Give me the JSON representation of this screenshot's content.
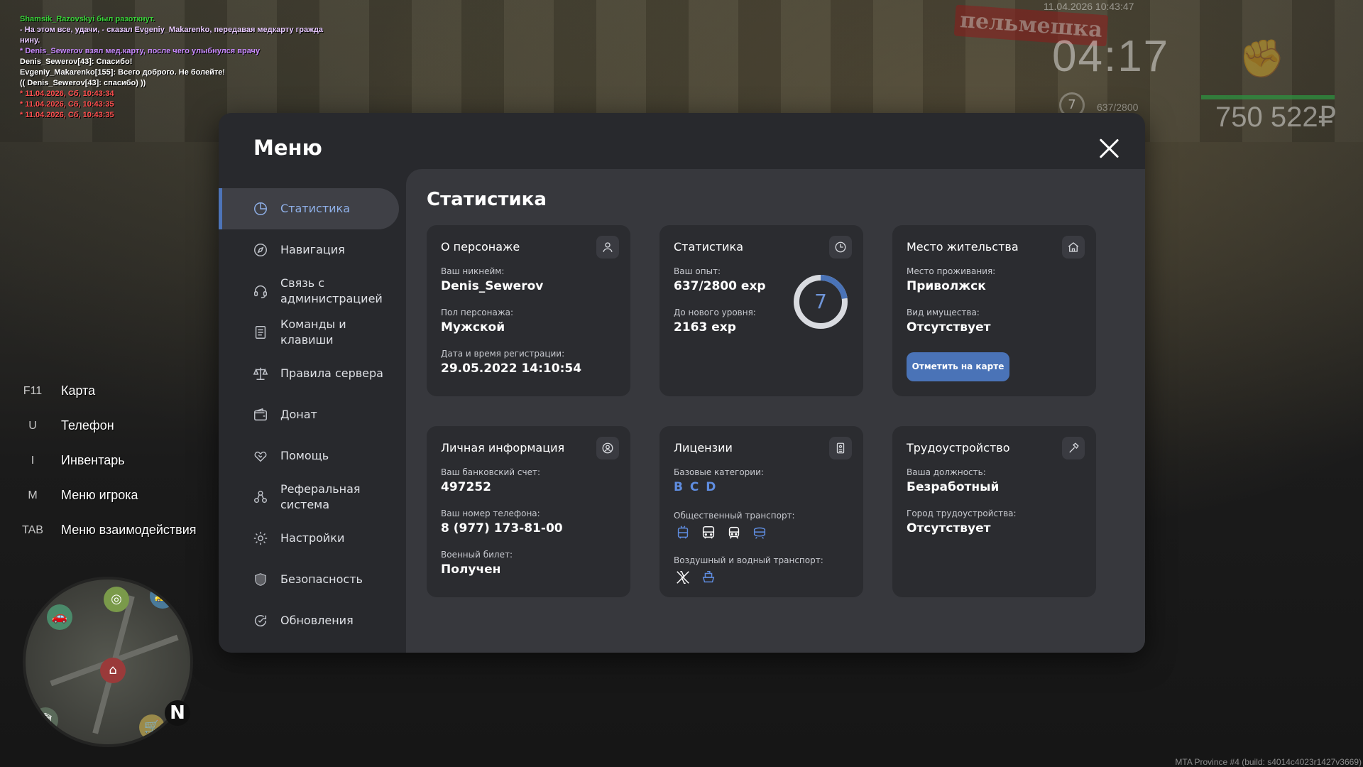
{
  "chat": [
    {
      "text": "Shamsik_Razovskyi был разоткнут.",
      "color": "#39d439"
    },
    {
      "text": "- На этом все, удачи, - сказал Evgeniy_Makarenko, передавая медкарту гражда",
      "color": "#e8c9ff"
    },
    {
      "text": "нину.",
      "color": "#e8c9ff"
    },
    {
      "text": "* Denis_Sewerov взял мед.карту, после чего улыбнулся врачу",
      "color": "#c98aff"
    },
    {
      "text": "Denis_Sewerov[43]: Спасибо!",
      "color": "#ffffff"
    },
    {
      "text": "Evgeniy_Makarenko[155]: Всего доброго. Не болейте!",
      "color": "#ffffff"
    },
    {
      "text": "(( Denis_Sewerov[43]: спасибо) ))",
      "color": "#ffffff"
    },
    {
      "text": "* 11.04.2026, Сб, 10:43:34",
      "color": "#ff4f4f"
    },
    {
      "text": "* 11.04.2026, Сб, 10:43:35",
      "color": "#ff4f4f"
    },
    {
      "text": "* 11.04.2026, Сб, 10:43:35",
      "color": "#ff4f4f"
    }
  ],
  "hud": {
    "datetime": "11.04.2026 10:43:47",
    "clock": "04:17",
    "level": "7",
    "exp": "637/2800",
    "money": "750 522₽"
  },
  "hotkeys": [
    {
      "key": "F11",
      "label": "Карта"
    },
    {
      "key": "U",
      "label": "Телефон"
    },
    {
      "key": "I",
      "label": "Инвентарь"
    },
    {
      "key": "M",
      "label": "Меню игрока"
    },
    {
      "key": "TAB",
      "label": "Меню взаимодействия"
    }
  ],
  "minimap": {
    "north": "N"
  },
  "build": "MTA Province #4 (build: s4014c4023r1427v3669)",
  "modal": {
    "title": "Меню",
    "content_title": "Статистика",
    "nav": [
      {
        "label": "Статистика",
        "icon": "chart-pie-icon"
      },
      {
        "label": "Навигация",
        "icon": "compass-icon"
      },
      {
        "label": "Связь с администрацией",
        "icon": "headset-icon"
      },
      {
        "label": "Команды и клавиши",
        "icon": "document-icon"
      },
      {
        "label": "Правила сервера",
        "icon": "scales-icon"
      },
      {
        "label": "Донат",
        "icon": "wallet-icon"
      },
      {
        "label": "Помощь",
        "icon": "handshake-icon"
      },
      {
        "label": "Реферальная система",
        "icon": "referral-icon"
      },
      {
        "label": "Настройки",
        "icon": "gear-icon"
      },
      {
        "label": "Безопасность",
        "icon": "shield-icon"
      },
      {
        "label": "Обновления",
        "icon": "refresh-icon"
      }
    ],
    "cards": {
      "character": {
        "title": "О персонаже",
        "nick_label": "Ваш никнейм:",
        "nick": "Denis_Sewerov",
        "gender_label": "Пол персонажа:",
        "gender": "Мужской",
        "reg_label": "Дата и время регистрации:",
        "reg": "29.05.2022 14:10:54"
      },
      "stats": {
        "title": "Статистика",
        "exp_label": "Ваш опыт:",
        "exp": "637/2800 exp",
        "next_label": "До нового уровня:",
        "next": "2163 exp",
        "level": "7",
        "progress": 0.2275
      },
      "residence": {
        "title": "Место жительства",
        "place_label": "Место проживания:",
        "place": "Приволжск",
        "property_label": "Вид имущества:",
        "property": "Отсутствует",
        "button": "Отметить на карте"
      },
      "personal": {
        "title": "Личная информация",
        "bank_label": "Ваш банковский счет:",
        "bank": "497252",
        "phone_label": "Ваш номер телефона:",
        "phone": "8 (977) 173-81-00",
        "military_label": "Военный билет:",
        "military": "Получен"
      },
      "licenses": {
        "title": "Лицензии",
        "base_label": "Базовые категории:",
        "base": "B C D",
        "public_label": "Общественный транспорт:",
        "public_icons": [
          "trolleybus-icon",
          "bus-icon",
          "tram-icon",
          "metro-icon"
        ],
        "air_label": "Воздушный и водный транспорт:",
        "air_icons": [
          "plane-icon",
          "boat-icon"
        ]
      },
      "job": {
        "title": "Трудоустройство",
        "position_label": "Ваша должность:",
        "position": "Безработный",
        "city_label": "Город трудоустройства:",
        "city": "Отсутствует"
      }
    }
  },
  "colors": {
    "accent": "#4a73b7",
    "accent_text": "#8fb0e8",
    "licence_letters": "#5f8de0"
  }
}
